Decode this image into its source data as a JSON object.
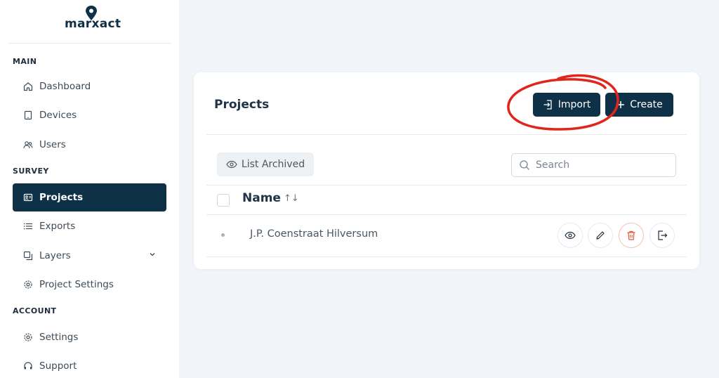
{
  "brand": {
    "name": "marxact"
  },
  "sidebar": {
    "sections": {
      "main": "MAIN",
      "survey": "SURVEY",
      "account": "ACCOUNT"
    },
    "items": [
      {
        "label": "Dashboard",
        "icon": "home-icon"
      },
      {
        "label": "Devices",
        "icon": "tablet-icon"
      },
      {
        "label": "Users",
        "icon": "users-icon"
      },
      {
        "label": "Projects",
        "icon": "projects-icon",
        "active": true
      },
      {
        "label": "Exports",
        "icon": "list-icon"
      },
      {
        "label": "Layers",
        "icon": "layers-icon",
        "expandable": true
      },
      {
        "label": "Project Settings",
        "icon": "gear-icon"
      },
      {
        "label": "Settings",
        "icon": "gear-icon"
      },
      {
        "label": "Support",
        "icon": "headset-icon"
      }
    ]
  },
  "projects": {
    "title": "Projects",
    "import_label": "Import",
    "create_label": "Create",
    "list_archived_label": "List Archived",
    "search_placeholder": "Search",
    "column_name": "Name",
    "sort_glyph": "↑↓",
    "rows": [
      {
        "name": "J.P. Coenstraat Hilversum"
      }
    ]
  },
  "colors": {
    "primary": "#0f3148",
    "annotation": "#e0251b",
    "danger": "#e5533c"
  }
}
